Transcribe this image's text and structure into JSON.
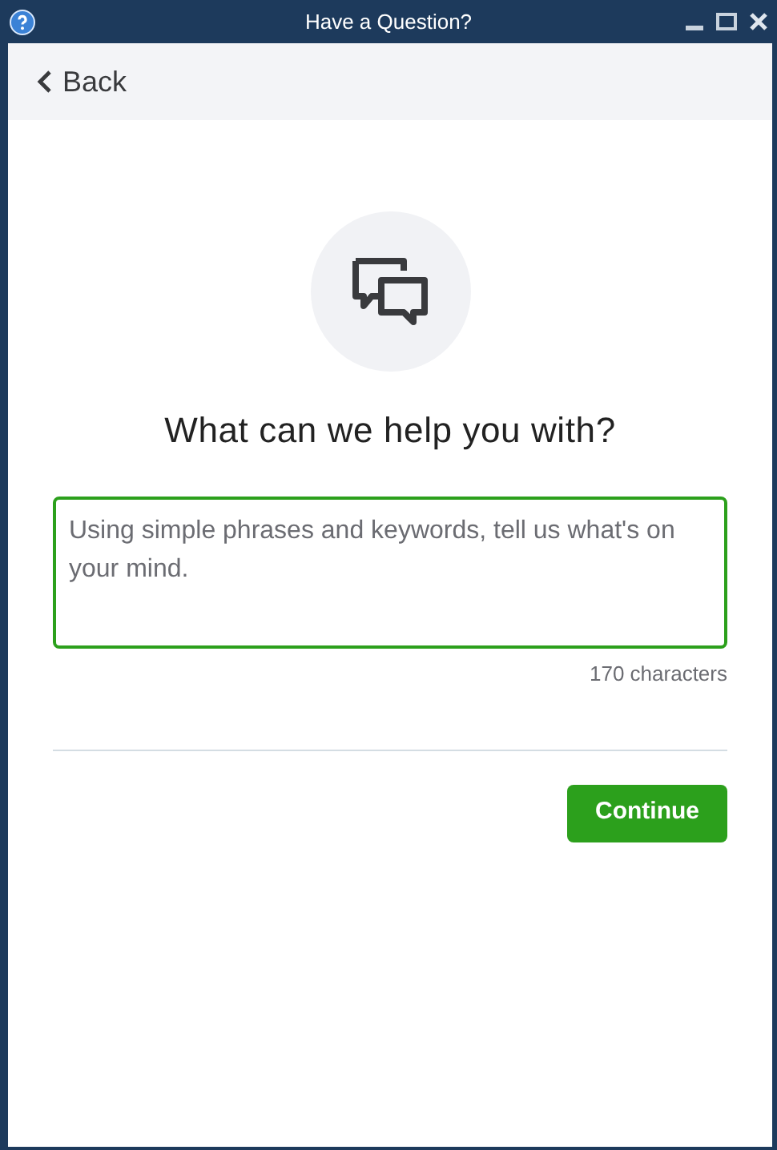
{
  "window": {
    "title": "Have a Question?"
  },
  "back": {
    "label": "Back"
  },
  "heading": "What can we help you with?",
  "question": {
    "placeholder": "Using simple phrases and keywords, tell us what's on your mind.",
    "focused": true
  },
  "counter": "170 characters",
  "buttons": [
    {
      "label": "Continue"
    }
  ]
}
